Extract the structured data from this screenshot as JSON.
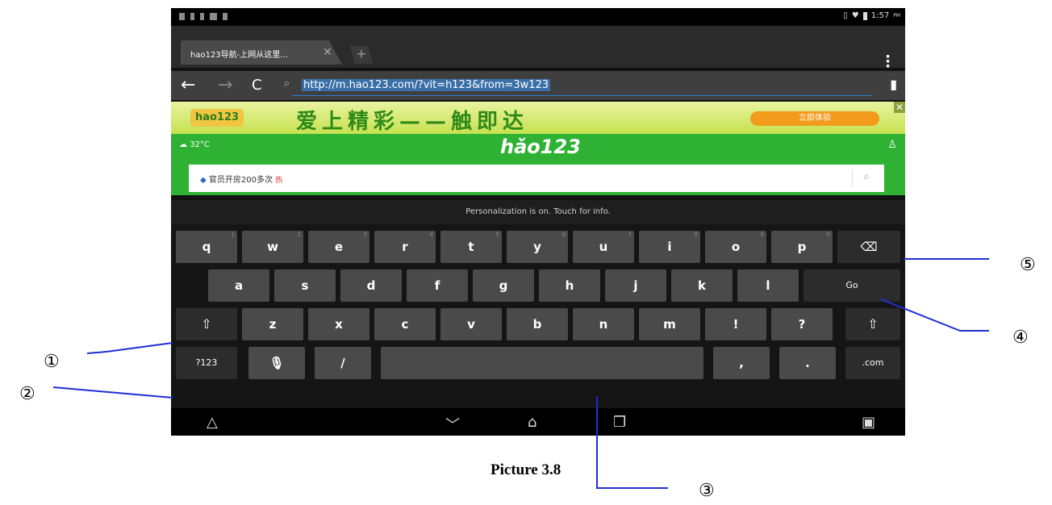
{
  "status_bar": {
    "time": "1:57",
    "ampm": "PM"
  },
  "browser": {
    "tab_title": "hao123导航-上网从这里...",
    "tab_close": "✕",
    "new_tab": "+",
    "url": "http://m.hao123.com/?vit=h123&from=3w123"
  },
  "banner": {
    "logo": "hao123",
    "slogan": "爱上精彩——触即达",
    "cta": "立即体验"
  },
  "page": {
    "weather": "32°C",
    "brand": "hǎo123",
    "search_text": "官员开房200多次",
    "search_hot": "热"
  },
  "keyboard": {
    "hint": "Personalization is on. Touch for info.",
    "row1": [
      "q",
      "w",
      "e",
      "r",
      "t",
      "y",
      "u",
      "i",
      "o",
      "p"
    ],
    "row1_hints": [
      "1",
      "2",
      "3",
      "4",
      "5",
      "6",
      "7",
      "8",
      "9",
      "0"
    ],
    "row2": [
      "a",
      "s",
      "d",
      "f",
      "g",
      "h",
      "j",
      "k",
      "l"
    ],
    "go": "Go",
    "shift_icon": "shift-icon",
    "row3": [
      "z",
      "x",
      "c",
      "v",
      "b",
      "n",
      "m",
      "!",
      "?"
    ],
    "symbols": "?123",
    "slash": "/",
    "comma": ",",
    "period": ".",
    "com": ".com",
    "backspace_icon": "backspace-icon"
  },
  "annotations": {
    "callouts": [
      "①",
      "②",
      "③",
      "④",
      "⑤"
    ],
    "caption": "Picture 3.8",
    "line_color": "#1f2fd6"
  }
}
